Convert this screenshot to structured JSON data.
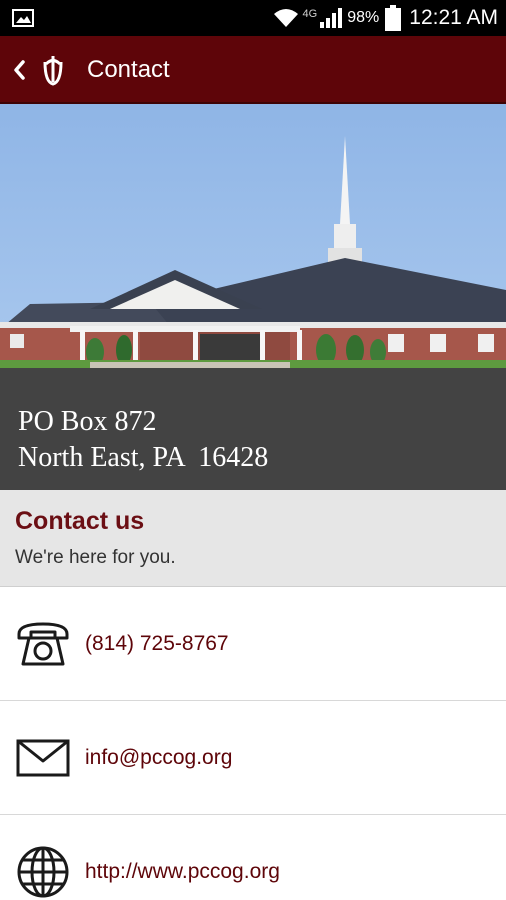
{
  "status_bar": {
    "network_type": "4G",
    "battery_percent": "98%",
    "time": "12:21 AM",
    "icons": [
      "image-notification-icon",
      "wifi-icon",
      "signal-icon",
      "battery-icon"
    ]
  },
  "action_bar": {
    "title": "Contact",
    "back_icon": "chevron-left-icon",
    "logo": "church-logo",
    "background_color": "#5e0509"
  },
  "hero": {
    "address_line1": "PO Box 872",
    "address_line2": "North East, PA  16428"
  },
  "contact_section": {
    "title": "Contact us",
    "subtitle": "We're here for you."
  },
  "contact_items": [
    {
      "icon": "telephone-icon",
      "text": "(814) 725-8767"
    },
    {
      "icon": "envelope-icon",
      "text": "info@pccog.org"
    },
    {
      "icon": "globe-icon",
      "text": "http://www.pccog.org"
    }
  ],
  "colors": {
    "accent": "#5e0509",
    "section_title": "#6b0f14",
    "section_background": "#e6e6e6"
  }
}
